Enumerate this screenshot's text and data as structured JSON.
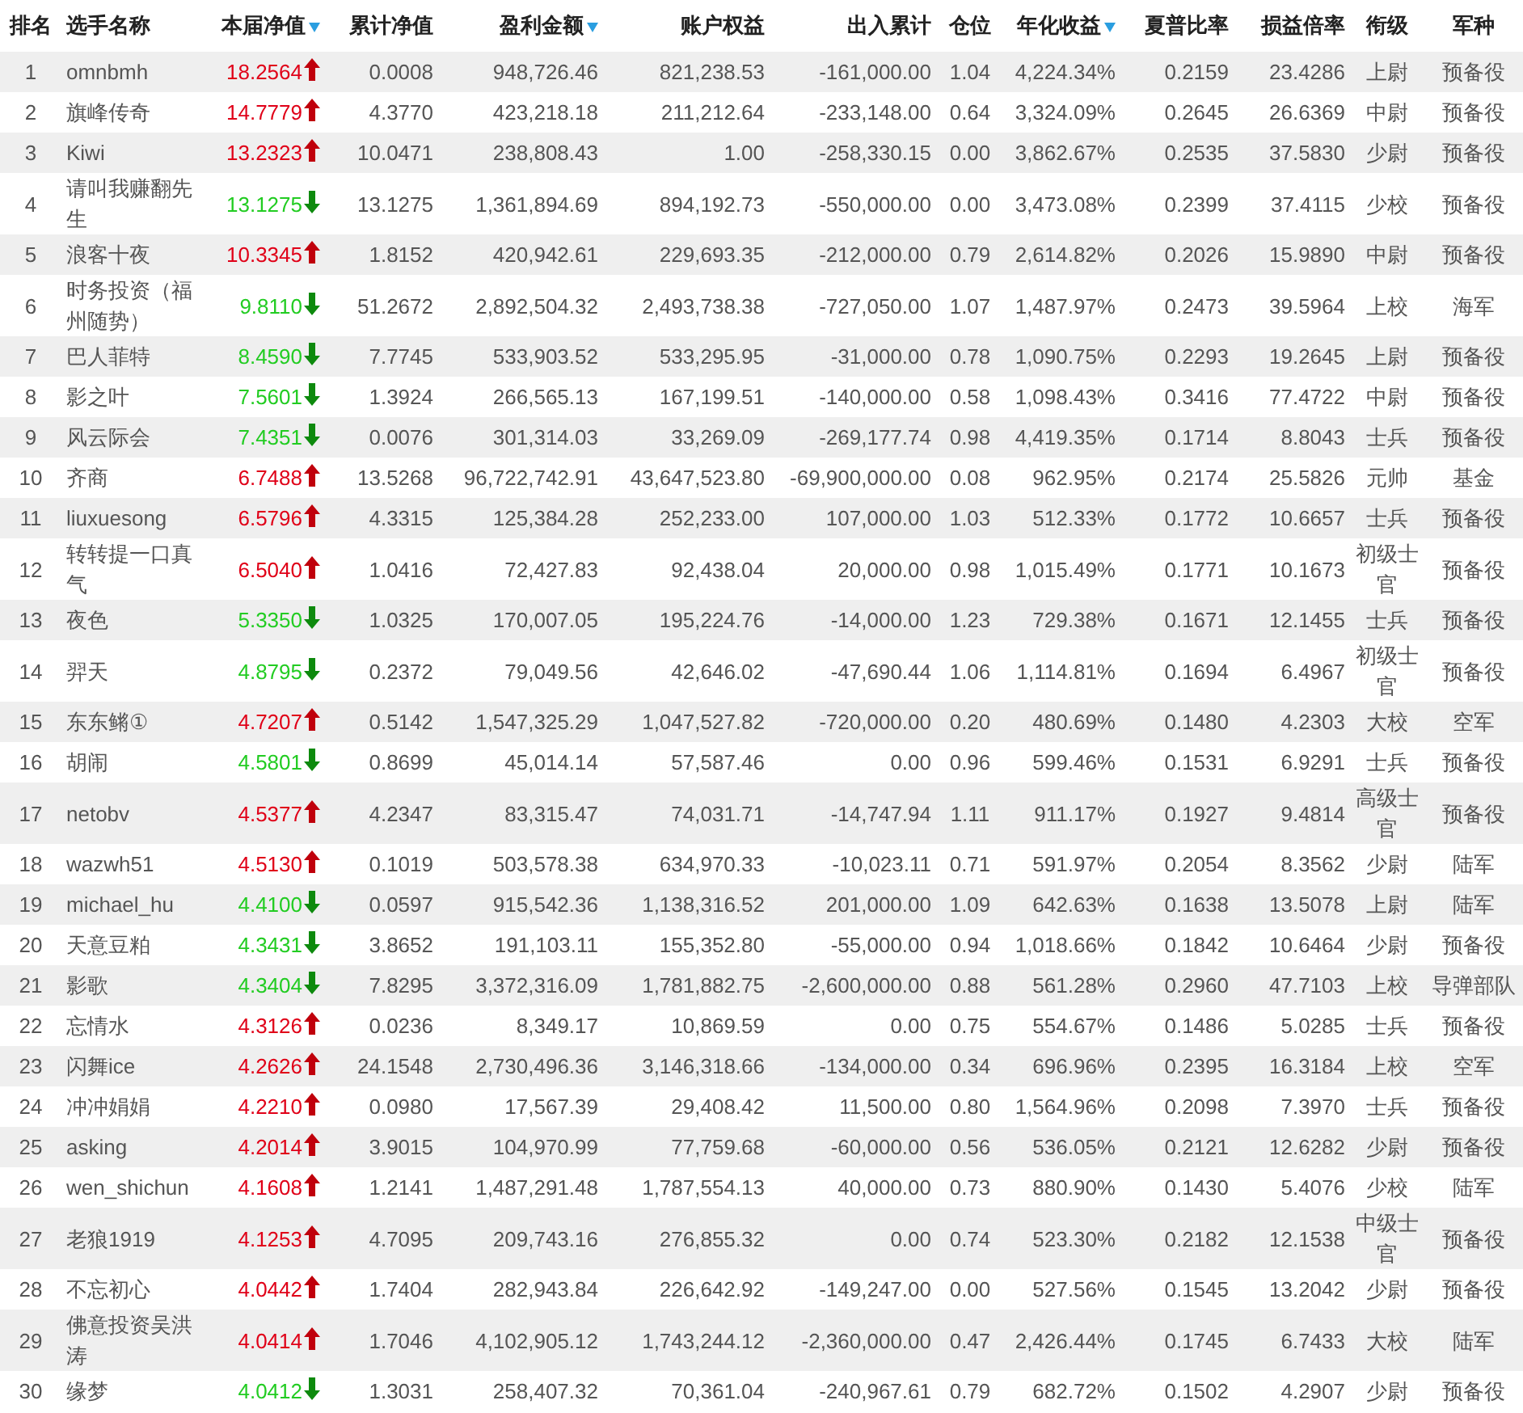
{
  "columns": [
    {
      "label": "排名",
      "sorted": false
    },
    {
      "label": "选手名称",
      "sorted": false
    },
    {
      "label": "本届净值",
      "sorted": true
    },
    {
      "label": "累计净值",
      "sorted": false
    },
    {
      "label": "盈利金额",
      "sorted": true
    },
    {
      "label": "账户权益",
      "sorted": false
    },
    {
      "label": "出入累计",
      "sorted": false
    },
    {
      "label": "仓位",
      "sorted": false
    },
    {
      "label": "年化收益",
      "sorted": true
    },
    {
      "label": "夏普比率",
      "sorted": false
    },
    {
      "label": "损益倍率",
      "sorted": false
    },
    {
      "label": "衔级",
      "sorted": false
    },
    {
      "label": "军种",
      "sorted": false
    }
  ],
  "rows": [
    {
      "cells": [
        "1",
        "omnbmh",
        "18.2564",
        "0.0008",
        "948,726.46",
        "821,238.53",
        "-161,000.00",
        "1.04",
        "4,224.34%",
        "0.2159",
        "23.4286",
        "上尉",
        "预备役"
      ],
      "rising": true
    },
    {
      "cells": [
        "2",
        "旗峰传奇",
        "14.7779",
        "4.3770",
        "423,218.18",
        "211,212.64",
        "-233,148.00",
        "0.64",
        "3,324.09%",
        "0.2645",
        "26.6369",
        "中尉",
        "预备役"
      ],
      "rising": true
    },
    {
      "cells": [
        "3",
        "Kiwi",
        "13.2323",
        "10.0471",
        "238,808.43",
        "1.00",
        "-258,330.15",
        "0.00",
        "3,862.67%",
        "0.2535",
        "37.5830",
        "少尉",
        "预备役"
      ],
      "rising": true
    },
    {
      "cells": [
        "4",
        "请叫我赚翻先生",
        "13.1275",
        "13.1275",
        "1,361,894.69",
        "894,192.73",
        "-550,000.00",
        "0.00",
        "3,473.08%",
        "0.2399",
        "37.4115",
        "少校",
        "预备役"
      ],
      "rising": false
    },
    {
      "cells": [
        "5",
        "浪客十夜",
        "10.3345",
        "1.8152",
        "420,942.61",
        "229,693.35",
        "-212,000.00",
        "0.79",
        "2,614.82%",
        "0.2026",
        "15.9890",
        "中尉",
        "预备役"
      ],
      "rising": true
    },
    {
      "cells": [
        "6",
        "时务投资（福州随势）",
        "9.8110",
        "51.2672",
        "2,892,504.32",
        "2,493,738.38",
        "-727,050.00",
        "1.07",
        "1,487.97%",
        "0.2473",
        "39.5964",
        "上校",
        "海军"
      ],
      "rising": false
    },
    {
      "cells": [
        "7",
        "巴人菲特",
        "8.4590",
        "7.7745",
        "533,903.52",
        "533,295.95",
        "-31,000.00",
        "0.78",
        "1,090.75%",
        "0.2293",
        "19.2645",
        "上尉",
        "预备役"
      ],
      "rising": false
    },
    {
      "cells": [
        "8",
        "影之叶",
        "7.5601",
        "1.3924",
        "266,565.13",
        "167,199.51",
        "-140,000.00",
        "0.58",
        "1,098.43%",
        "0.3416",
        "77.4722",
        "中尉",
        "预备役"
      ],
      "rising": false
    },
    {
      "cells": [
        "9",
        "风云际会",
        "7.4351",
        "0.0076",
        "301,314.03",
        "33,269.09",
        "-269,177.74",
        "0.98",
        "4,419.35%",
        "0.1714",
        "8.8043",
        "士兵",
        "预备役"
      ],
      "rising": false
    },
    {
      "cells": [
        "10",
        "齐商",
        "6.7488",
        "13.5268",
        "96,722,742.91",
        "43,647,523.80",
        "-69,900,000.00",
        "0.08",
        "962.95%",
        "0.2174",
        "25.5826",
        "元帅",
        "基金"
      ],
      "rising": true
    },
    {
      "cells": [
        "11",
        "liuxuesong",
        "6.5796",
        "4.3315",
        "125,384.28",
        "252,233.00",
        "107,000.00",
        "1.03",
        "512.33%",
        "0.1772",
        "10.6657",
        "士兵",
        "预备役"
      ],
      "rising": true
    },
    {
      "cells": [
        "12",
        "转转提一口真气",
        "6.5040",
        "1.0416",
        "72,427.83",
        "92,438.04",
        "20,000.00",
        "0.98",
        "1,015.49%",
        "0.1771",
        "10.1673",
        "初级士官",
        "预备役"
      ],
      "rising": true
    },
    {
      "cells": [
        "13",
        "夜色",
        "5.3350",
        "1.0325",
        "170,007.05",
        "195,224.76",
        "-14,000.00",
        "1.23",
        "729.38%",
        "0.1671",
        "12.1455",
        "士兵",
        "预备役"
      ],
      "rising": false
    },
    {
      "cells": [
        "14",
        "羿天",
        "4.8795",
        "0.2372",
        "79,049.56",
        "42,646.02",
        "-47,690.44",
        "1.06",
        "1,114.81%",
        "0.1694",
        "6.4967",
        "初级士官",
        "预备役"
      ],
      "rising": false
    },
    {
      "cells": [
        "15",
        "东东鳉①",
        "4.7207",
        "0.5142",
        "1,547,325.29",
        "1,047,527.82",
        "-720,000.00",
        "0.20",
        "480.69%",
        "0.1480",
        "4.2303",
        "大校",
        "空军"
      ],
      "rising": true
    },
    {
      "cells": [
        "16",
        "胡闹",
        "4.5801",
        "0.8699",
        "45,014.14",
        "57,587.46",
        "0.00",
        "0.96",
        "599.46%",
        "0.1531",
        "6.9291",
        "士兵",
        "预备役"
      ],
      "rising": false
    },
    {
      "cells": [
        "17",
        "netobv",
        "4.5377",
        "4.2347",
        "83,315.47",
        "74,031.71",
        "-14,747.94",
        "1.11",
        "911.17%",
        "0.1927",
        "9.4814",
        "高级士官",
        "预备役"
      ],
      "rising": true
    },
    {
      "cells": [
        "18",
        "wazwh51",
        "4.5130",
        "0.1019",
        "503,578.38",
        "634,970.33",
        "-10,023.11",
        "0.71",
        "591.97%",
        "0.2054",
        "8.3562",
        "少尉",
        "陆军"
      ],
      "rising": true
    },
    {
      "cells": [
        "19",
        "michael_hu",
        "4.4100",
        "0.0597",
        "915,542.36",
        "1,138,316.52",
        "201,000.00",
        "1.09",
        "642.63%",
        "0.1638",
        "13.5078",
        "上尉",
        "陆军"
      ],
      "rising": false
    },
    {
      "cells": [
        "20",
        "天意豆粕",
        "4.3431",
        "3.8652",
        "191,103.11",
        "155,352.80",
        "-55,000.00",
        "0.94",
        "1,018.66%",
        "0.1842",
        "10.6464",
        "少尉",
        "预备役"
      ],
      "rising": false
    },
    {
      "cells": [
        "21",
        "影歌",
        "4.3404",
        "7.8295",
        "3,372,316.09",
        "1,781,882.75",
        "-2,600,000.00",
        "0.88",
        "561.28%",
        "0.2960",
        "47.7103",
        "上校",
        "导弹部队"
      ],
      "rising": false
    },
    {
      "cells": [
        "22",
        "忘情水",
        "4.3126",
        "0.0236",
        "8,349.17",
        "10,869.59",
        "0.00",
        "0.75",
        "554.67%",
        "0.1486",
        "5.0285",
        "士兵",
        "预备役"
      ],
      "rising": true
    },
    {
      "cells": [
        "23",
        "闪舞ice",
        "4.2626",
        "24.1548",
        "2,730,496.36",
        "3,146,318.66",
        "-134,000.00",
        "0.34",
        "696.96%",
        "0.2395",
        "16.3184",
        "上校",
        "空军"
      ],
      "rising": true
    },
    {
      "cells": [
        "24",
        "冲冲娟娟",
        "4.2210",
        "0.0980",
        "17,567.39",
        "29,408.42",
        "11,500.00",
        "0.80",
        "1,564.96%",
        "0.2098",
        "7.3970",
        "士兵",
        "预备役"
      ],
      "rising": true
    },
    {
      "cells": [
        "25",
        "asking",
        "4.2014",
        "3.9015",
        "104,970.99",
        "77,759.68",
        "-60,000.00",
        "0.56",
        "536.05%",
        "0.2121",
        "12.6282",
        "少尉",
        "预备役"
      ],
      "rising": true
    },
    {
      "cells": [
        "26",
        "wen_shichun",
        "4.1608",
        "1.2141",
        "1,487,291.48",
        "1,787,554.13",
        "40,000.00",
        "0.73",
        "880.90%",
        "0.1430",
        "5.4076",
        "少校",
        "陆军"
      ],
      "rising": true
    },
    {
      "cells": [
        "27",
        "老狼1919",
        "4.1253",
        "4.7095",
        "209,743.16",
        "276,855.32",
        "0.00",
        "0.74",
        "523.30%",
        "0.2182",
        "12.1538",
        "中级士官",
        "预备役"
      ],
      "rising": true
    },
    {
      "cells": [
        "28",
        "不忘初心",
        "4.0442",
        "1.7404",
        "282,943.84",
        "226,642.92",
        "-149,247.00",
        "0.00",
        "527.56%",
        "0.1545",
        "13.2042",
        "少尉",
        "预备役"
      ],
      "rising": true
    },
    {
      "cells": [
        "29",
        "佛意投资吴洪涛",
        "4.0414",
        "1.7046",
        "4,102,905.12",
        "1,743,244.12",
        "-2,360,000.00",
        "0.47",
        "2,426.44%",
        "0.1745",
        "6.7433",
        "大校",
        "陆军"
      ],
      "rising": true
    },
    {
      "cells": [
        "30",
        "缘梦",
        "4.0412",
        "1.3031",
        "258,407.32",
        "70,361.04",
        "-240,967.61",
        "0.79",
        "682.72%",
        "0.1502",
        "4.2907",
        "少尉",
        "预备役"
      ],
      "rising": false
    }
  ]
}
